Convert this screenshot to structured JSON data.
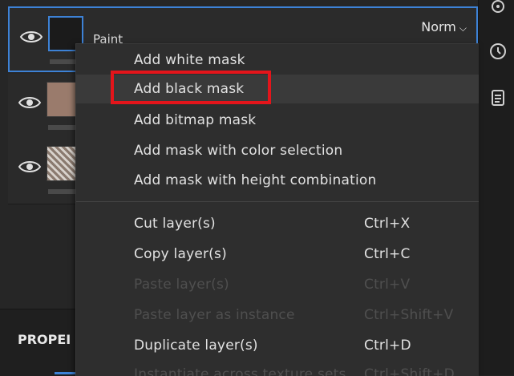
{
  "layers": [
    {
      "name": "Paint",
      "blend_mode": "Norm",
      "thumbnail": "black",
      "selected": true
    },
    {
      "thumbnail": "skin"
    },
    {
      "thumbnail": "texture"
    }
  ],
  "properties_title": "PROPEI",
  "context_menu": {
    "items": [
      {
        "label": "Add white mask",
        "shortcut": "",
        "enabled": true
      },
      {
        "label": "Add black mask",
        "shortcut": "",
        "enabled": true,
        "highlighted": true
      },
      {
        "label": "Add bitmap mask",
        "shortcut": "",
        "enabled": true
      },
      {
        "label": "Add mask with color selection",
        "shortcut": "",
        "enabled": true
      },
      {
        "label": "Add mask with height combination",
        "shortcut": "",
        "enabled": true
      },
      {
        "label": "Cut layer(s)",
        "shortcut": "Ctrl+X",
        "enabled": true
      },
      {
        "label": "Copy layer(s)",
        "shortcut": "Ctrl+C",
        "enabled": true
      },
      {
        "label": "Paste layer(s)",
        "shortcut": "Ctrl+V",
        "enabled": false
      },
      {
        "label": "Paste layer as instance",
        "shortcut": "Ctrl+Shift+V",
        "enabled": false
      },
      {
        "label": "Duplicate layer(s)",
        "shortcut": "Ctrl+D",
        "enabled": true
      },
      {
        "label": "Instantiate across texture sets",
        "shortcut": "Ctrl+Shift+D",
        "enabled": false
      }
    ]
  },
  "icons": {
    "eye": "eye-icon",
    "history": "history-icon",
    "clipboard": "clipboard-icon",
    "settings": "settings-icon"
  },
  "colors": {
    "selection": "#3d82d6",
    "highlight_box": "#e4151b"
  }
}
